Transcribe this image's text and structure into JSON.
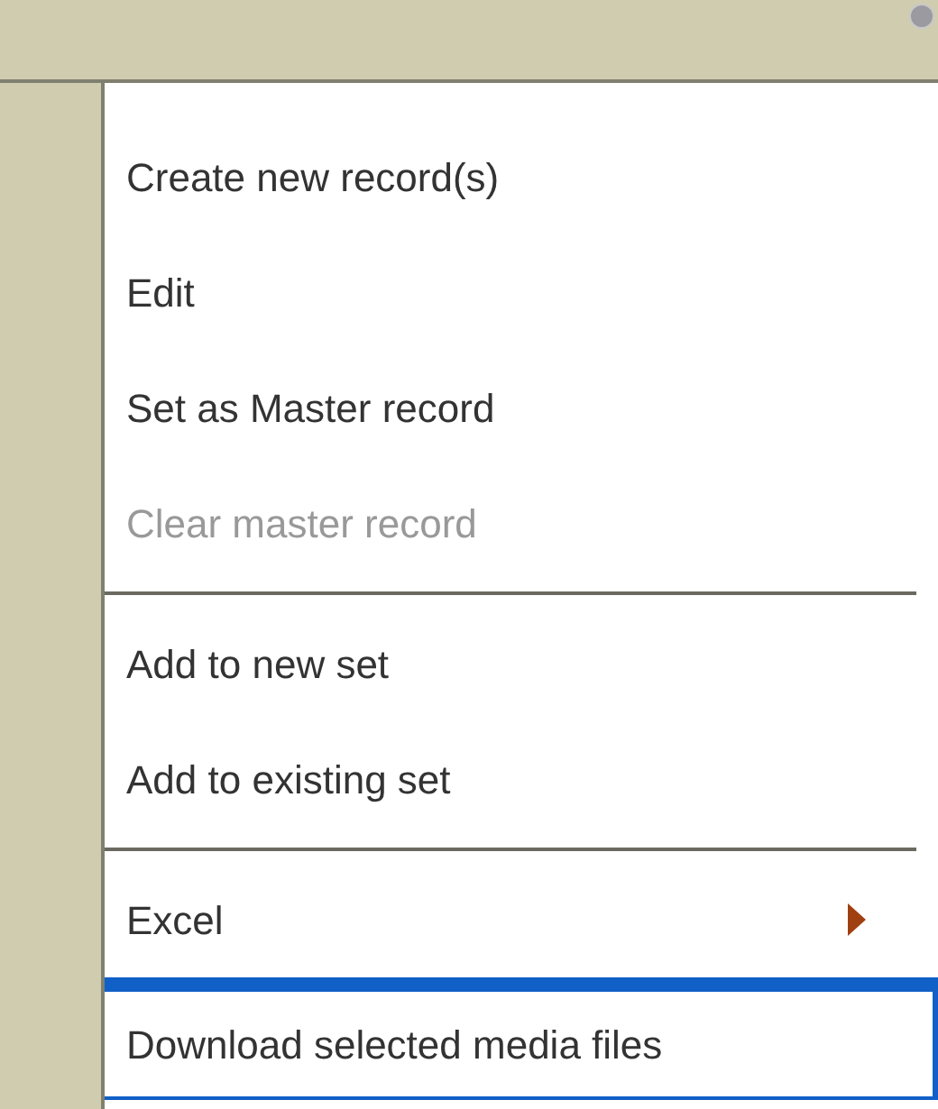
{
  "groups": [
    {
      "items": [
        {
          "label": "Create new record(s)",
          "disabled": false,
          "selected": false,
          "submenu": false
        },
        {
          "label": "Edit",
          "disabled": false,
          "selected": false,
          "submenu": false
        },
        {
          "label": "Set as Master record",
          "disabled": false,
          "selected": false,
          "submenu": false
        },
        {
          "label": "Clear master record",
          "disabled": true,
          "selected": false,
          "submenu": false
        }
      ]
    },
    {
      "items": [
        {
          "label": "Add to new set",
          "disabled": false,
          "selected": false,
          "submenu": false
        },
        {
          "label": "Add to existing set",
          "disabled": false,
          "selected": false,
          "submenu": false
        }
      ]
    },
    {
      "items": [
        {
          "label": "Excel",
          "disabled": false,
          "selected": false,
          "submenu": true
        },
        {
          "label": "Download selected media files",
          "disabled": false,
          "selected": true,
          "submenu": false
        }
      ]
    }
  ]
}
